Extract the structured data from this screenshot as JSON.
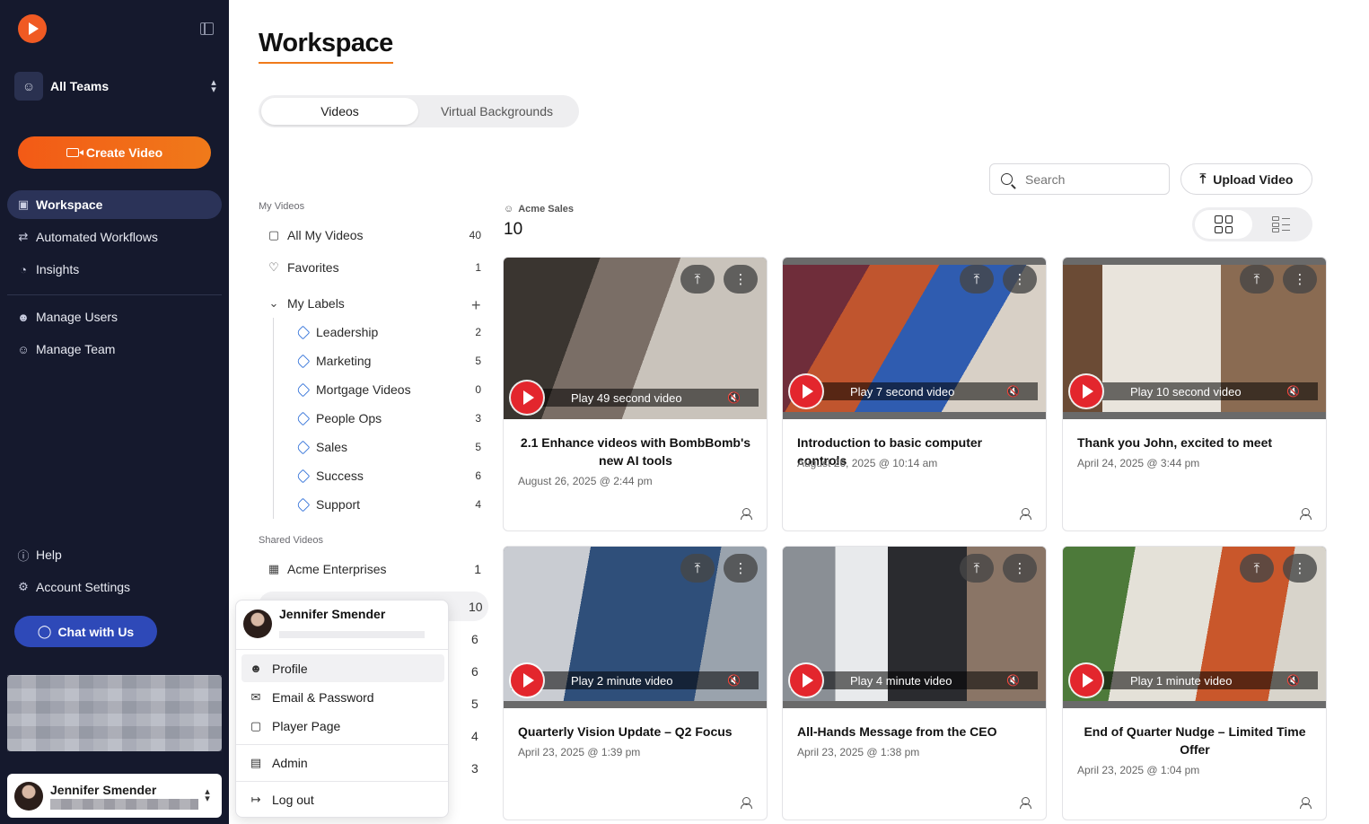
{
  "sidebar": {
    "team": {
      "name": "All Teams"
    },
    "create_label": "Create Video",
    "nav": [
      {
        "label": "Workspace",
        "icon": "workspace-icon",
        "active": true
      },
      {
        "label": "Automated Workflows",
        "icon": "workflow-icon"
      },
      {
        "label": "Insights",
        "icon": "insights-icon"
      },
      {
        "label": "Manage Users",
        "icon": "user-icon"
      },
      {
        "label": "Manage Team",
        "icon": "team-icon"
      }
    ],
    "help_label": "Help",
    "settings_label": "Account Settings",
    "chat_label": "Chat with Us",
    "user_name": "Jennifer Smender"
  },
  "main": {
    "title": "Workspace",
    "tabs": [
      {
        "label": "Videos",
        "active": true
      },
      {
        "label": "Virtual Backgrounds"
      }
    ],
    "search_placeholder": "Search",
    "upload_label": "Upload Video"
  },
  "library": {
    "my_videos_heading": "My Videos",
    "all_my_videos": {
      "label": "All My Videos",
      "count": "40"
    },
    "favorites": {
      "label": "Favorites",
      "count": "1"
    },
    "my_labels": {
      "label": "My Labels"
    },
    "labels": [
      {
        "label": "Leadership",
        "count": "2"
      },
      {
        "label": "Marketing",
        "count": "5"
      },
      {
        "label": "Mortgage Videos",
        "count": "0"
      },
      {
        "label": "People Ops",
        "count": "3"
      },
      {
        "label": "Sales",
        "count": "5"
      },
      {
        "label": "Success",
        "count": "6"
      },
      {
        "label": "Support",
        "count": "4"
      }
    ],
    "shared_heading": "Shared Videos",
    "acme_enterprises": {
      "label": "Acme Enterprises",
      "count": "1"
    },
    "hidden_counts": [
      "10",
      "6",
      "6",
      "5",
      "4",
      "3"
    ]
  },
  "group": {
    "name": "Acme Sales",
    "count": "10"
  },
  "videos": [
    {
      "title": "2.1 Enhance videos with BombBomb's new AI tools",
      "date": "August 26, 2025 @ 2:44 pm",
      "play": "Play 49 second video"
    },
    {
      "title": "Introduction to basic computer controls",
      "date": "August 26, 2025 @ 10:14 am",
      "play": "Play 7 second video"
    },
    {
      "title": "Thank you John, excited to meet",
      "date": "April 24, 2025 @ 3:44 pm",
      "play": "Play 10 second video"
    },
    {
      "title": "Quarterly Vision Update – Q2 Focus",
      "date": "April 23, 2025 @ 1:39 pm",
      "play": "Play 2 minute video"
    },
    {
      "title": "All-Hands Message from the CEO",
      "date": "April 23, 2025 @ 1:38 pm",
      "play": "Play 4 minute video"
    },
    {
      "title": "End of Quarter Nudge – Limited Time Offer",
      "date": "April 23, 2025 @ 1:04 pm",
      "play": "Play 1 minute video"
    }
  ],
  "popup": {
    "name": "Jennifer Smender",
    "items": [
      "Profile",
      "Email & Password",
      "Player Page",
      "Admin",
      "Log out"
    ]
  }
}
